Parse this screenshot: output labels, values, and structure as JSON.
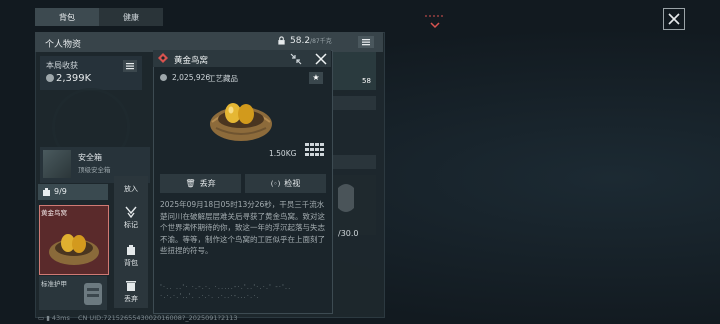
{
  "tabs": [
    "背包",
    "健康"
  ],
  "panel": {
    "title": "个人物资",
    "weight_value": "58.2",
    "weight_unit": "/87千克"
  },
  "stat": {
    "label": "本局收获",
    "value": "2,399K"
  },
  "safe": {
    "title": "安全箱",
    "subtitle": "顶级安全箱"
  },
  "slot": {
    "count": "9/9",
    "item_name": "黄金鸟窝",
    "item2_name": "标准护甲"
  },
  "sidemenu": {
    "put_in": "放入",
    "mark": "标记",
    "bag": "背包",
    "discard": "丢弃"
  },
  "popup": {
    "title": "黄金鸟窝",
    "price": "2,025,926",
    "category": "工艺藏品",
    "weight": "1.50KG",
    "discard_label": "丢弃",
    "inspect_label": "检视",
    "description": "2025年09月18日05时13分26秒，干员三千流水楚问川在破解层层难关后寻获了黄金鸟窝。致对这个世界满怀期待的你，致这一年的浮沉起落与失志不渝。等等，制作这个鸟窝的工匠似乎在上面刻了些扭捏的符号。",
    "symbols": "'·.. ..'· ·.-.·. ·.....-·.'..'·.·.' -·'.. ·.·.·.'..'. .·.·. .·..·-...·.·."
  },
  "right": {
    "item_count": "58",
    "helmet_durability_cur": "",
    "helmet_durability_max": "/30.0"
  },
  "footer": {
    "ping": "43ms",
    "uid": "CN UID:7215265543002016008?_2025091?2113"
  },
  "colors": {
    "accent_red": "#d8534f",
    "slot_border": "#d07a74",
    "gold": "#d9a62a"
  }
}
